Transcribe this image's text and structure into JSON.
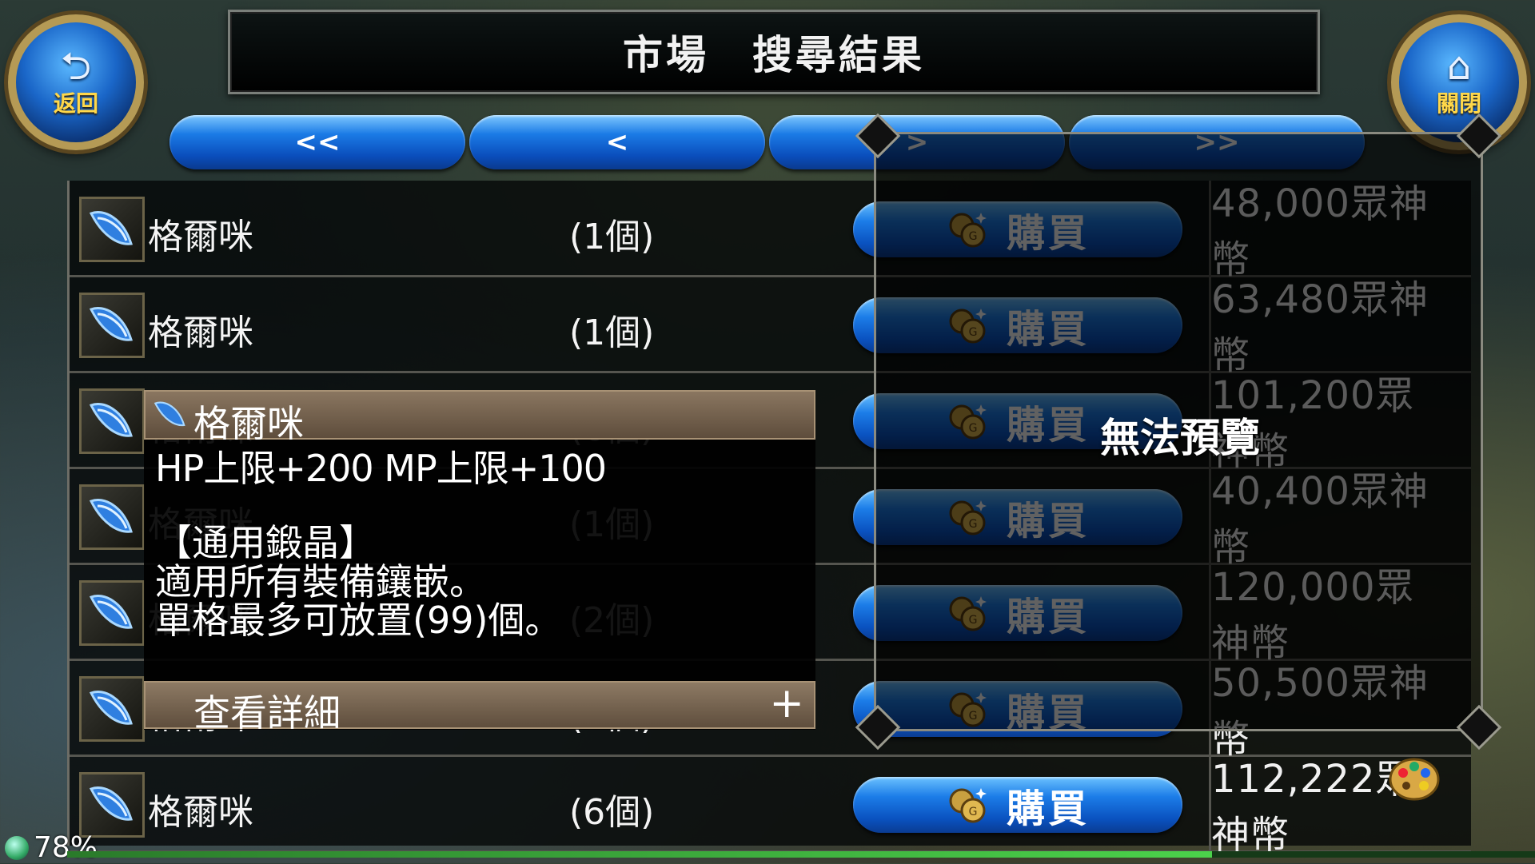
{
  "header": {
    "title": "市場　搜尋結果",
    "back_label": "返回",
    "close_label": "關閉"
  },
  "pagination": {
    "first": "<<",
    "prev": "<",
    "next": ">",
    "last": ">>"
  },
  "rows": [
    {
      "name": "格爾咪",
      "qty": "(1個)",
      "buy": "購買",
      "price": "48,000眾神幣"
    },
    {
      "name": "格爾咪",
      "qty": "(1個)",
      "buy": "購買",
      "price": "63,480眾神幣"
    },
    {
      "name": "格爾咪",
      "qty": "(6個)",
      "buy": "購買",
      "price": "101,200眾神幣"
    },
    {
      "name": "格爾咪",
      "qty": "(1個)",
      "buy": "購買",
      "price": "40,400眾神幣"
    },
    {
      "name": "格爾咪",
      "qty": "(2個)",
      "buy": "購買",
      "price": "120,000眾神幣"
    },
    {
      "name": "格爾咪",
      "qty": "(1個)",
      "buy": "購買",
      "price": "50,500眾神幣"
    },
    {
      "name": "格爾咪",
      "qty": "(6個)",
      "buy": "購買",
      "price": "112,222眾神幣"
    }
  ],
  "tooltip": {
    "name": "格爾咪",
    "stats": "HP上限+200  MP上限+100",
    "category": "【通用鍛晶】",
    "desc1": "適用所有裝備鑲嵌。",
    "desc2": "單格最多可放置(99)個。",
    "detail_label": "查看詳細",
    "detail_plus": "+"
  },
  "preview": {
    "text": "無法預覽"
  },
  "status": {
    "loading_percent": "78%",
    "progress": 0.78
  },
  "colors": {
    "button_blue": "#1b7be6",
    "accent_gold": "#ffd84a",
    "panel_border": "#55554f"
  }
}
